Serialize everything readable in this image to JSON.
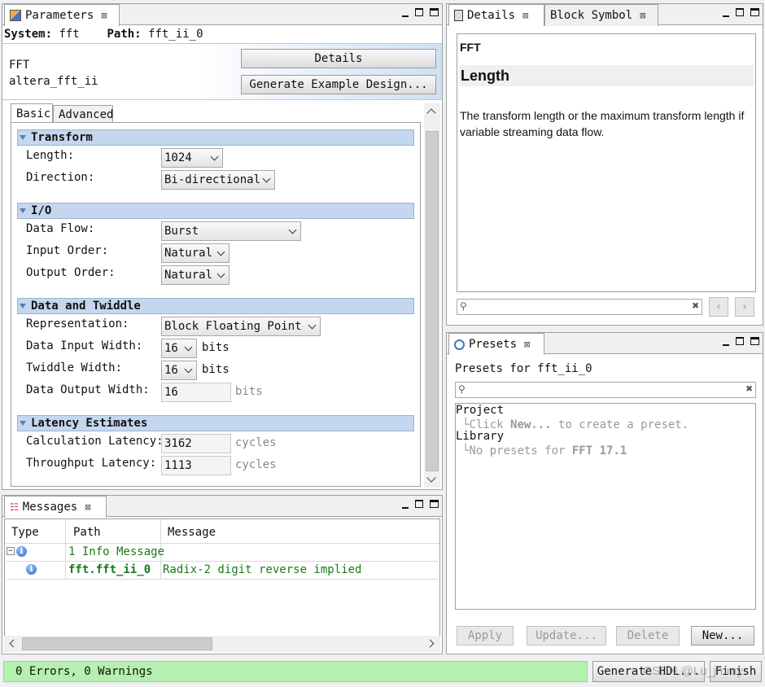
{
  "parameters_panel": {
    "tab_title": "Parameters",
    "system_label": "System:",
    "system_value": "fft",
    "path_label": "Path:",
    "path_value": "fft_ii_0",
    "component_name": "FFT",
    "component_id": "altera_fft_ii",
    "details_button": "Details",
    "generate_example_button": "Generate Example Design...",
    "tabs": [
      "Basic",
      "Advanced"
    ],
    "sections": {
      "transform": {
        "title": "Transform",
        "length_label": "Length:",
        "length_value": "1024",
        "direction_label": "Direction:",
        "direction_value": "Bi-directional"
      },
      "io": {
        "title": "I/O",
        "data_flow_label": "Data Flow:",
        "data_flow_value": "Burst",
        "input_order_label": "Input Order:",
        "input_order_value": "Natural",
        "output_order_label": "Output Order:",
        "output_order_value": "Natural"
      },
      "data_twiddle": {
        "title": "Data and Twiddle",
        "representation_label": "Representation:",
        "representation_value": "Block Floating Point",
        "data_input_width_label": "Data Input Width:",
        "data_input_width_value": "16",
        "twiddle_width_label": "Twiddle Width:",
        "twiddle_width_value": "16",
        "data_output_width_label": "Data Output Width:",
        "data_output_width_value": "16",
        "bits_unit": "bits"
      },
      "latency": {
        "title": "Latency Estimates",
        "calc_label": "Calculation Latency:",
        "calc_value": "3162",
        "throughput_label": "Throughput Latency:",
        "throughput_value": "1113",
        "cycles_unit": "cycles"
      }
    }
  },
  "messages_panel": {
    "tab_title": "Messages",
    "columns": [
      "Type",
      "Path",
      "Message"
    ],
    "group_row": "1 Info Message",
    "row_path": "fft.fft_ii_0",
    "row_message": "Radix-2 digit reverse implied"
  },
  "details_panel": {
    "tab_details": "Details",
    "tab_block_symbol": "Block Symbol",
    "heading_small": "FFT",
    "heading_large": "Length",
    "description": "The transform length or the maximum transform length if variable streaming data flow."
  },
  "presets_panel": {
    "tab_title": "Presets",
    "presets_for": "Presets for fft_ii_0",
    "project_label": "Project",
    "project_hint_prefix": "Click ",
    "project_hint_bold": "New...",
    "project_hint_suffix": " to create a preset.",
    "library_label": "Library",
    "library_hint_prefix": "No presets for ",
    "library_hint_bold": "FFT 17.1",
    "apply_button": "Apply",
    "update_button": "Update...",
    "delete_button": "Delete",
    "new_button": "New..."
  },
  "status_bar": {
    "summary": "0 Errors, 0 Warnings",
    "generate_hdl_button": "Generate HDL...",
    "finish_button": "Finish",
    "watermark": "CSDN @Lu_jmmy"
  },
  "colors": {
    "section_header": "#c5d7ee",
    "status_ok": "#b6f0b0",
    "info_text": "#1a7a1a"
  }
}
